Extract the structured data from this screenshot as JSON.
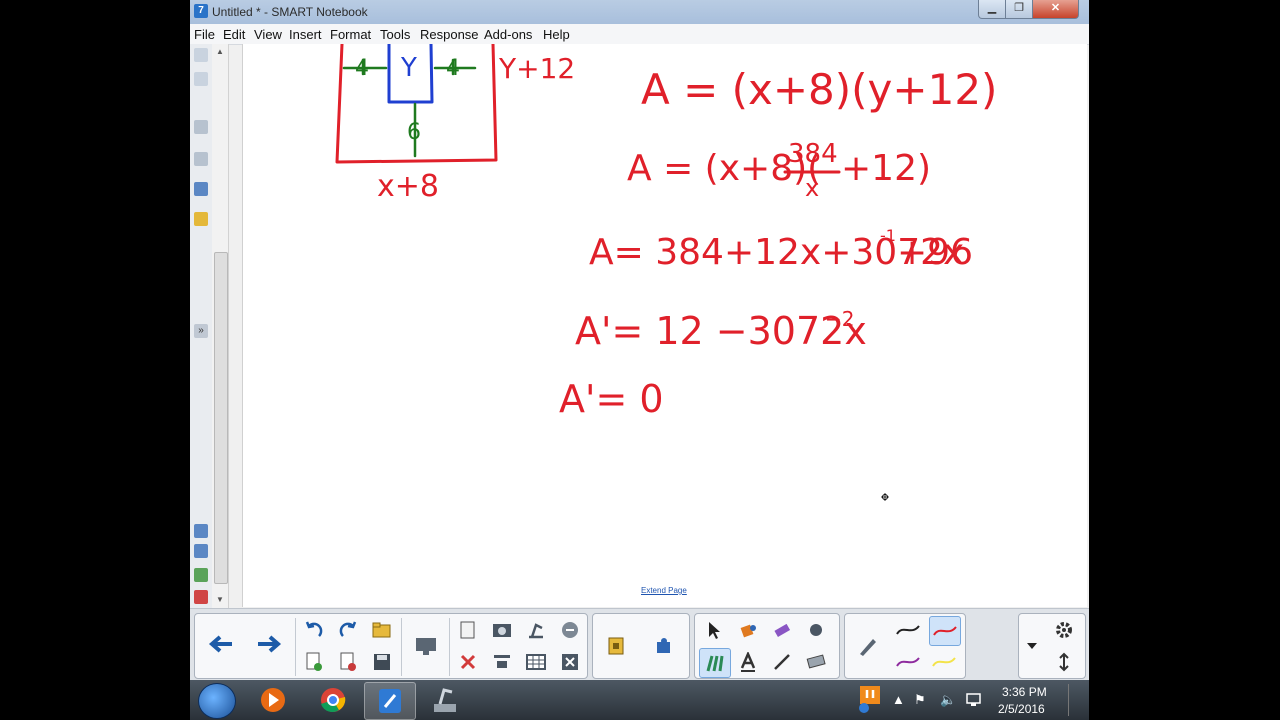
{
  "window": {
    "title": "Untitled * - SMART Notebook",
    "app_icon_glyph": "7",
    "min": "▁",
    "max": "❐",
    "close": "✕"
  },
  "menu": [
    "File",
    "Edit",
    "View",
    "Insert",
    "Format",
    "Tools",
    "Response",
    "Add-ons",
    "Help"
  ],
  "canvas": {
    "handwriting": {
      "diagram_top_label": "Y+12",
      "inner_label": "Y",
      "left_margin": "4",
      "right_margin": "4",
      "bottom_margin": "6",
      "diagram_bottom_label": "x+8",
      "line1": "A = (x+8)(y+12)",
      "line2_prefix": "A = (x+8)(",
      "line2_numer": "384",
      "line2_denom": "x",
      "line2_suffix": "+12)",
      "line3": "A= 384+12x+3072x",
      "line3_exp": "-1",
      "line3_tail": "+96",
      "line4": "A'= 12 −3072x",
      "line4_exp": "−2",
      "line5": "A'= 0"
    },
    "ink_color": "#e0202a",
    "diagram_inner_color": "#1f3fd1",
    "diagram_margin_color": "#1f7a1f",
    "extend_page": "Extend Page"
  },
  "toolbar": {
    "icons": [
      "back-arrow-icon",
      "forward-arrow-icon",
      "undo-icon",
      "redo-icon",
      "open-folder-icon",
      "add-page-icon",
      "delete-page-icon",
      "save-icon",
      "screen-shade-icon",
      "paste-icon",
      "screen-capture-icon",
      "document-camera-icon",
      "clear-page-icon",
      "delete-icon",
      "display-icon",
      "table-icon",
      "full-screen-icon",
      "lesson-activity-icon",
      "addon-puzzle-icon",
      "select-arrow-icon",
      "fill-bucket-icon",
      "eraser-icon",
      "pen-icon",
      "creative-pens-icon",
      "text-icon",
      "line-icon",
      "eraser-tool-icon",
      "properties-pen-icon",
      "pen-black-icon",
      "pen-red-icon",
      "pen-purple-icon",
      "pen-yellow-icon",
      "dropdown-icon",
      "settings-icon",
      "move-toolbar-icon"
    ]
  },
  "taskbar": {
    "time": "3:36 PM",
    "date": "2/5/2016"
  }
}
